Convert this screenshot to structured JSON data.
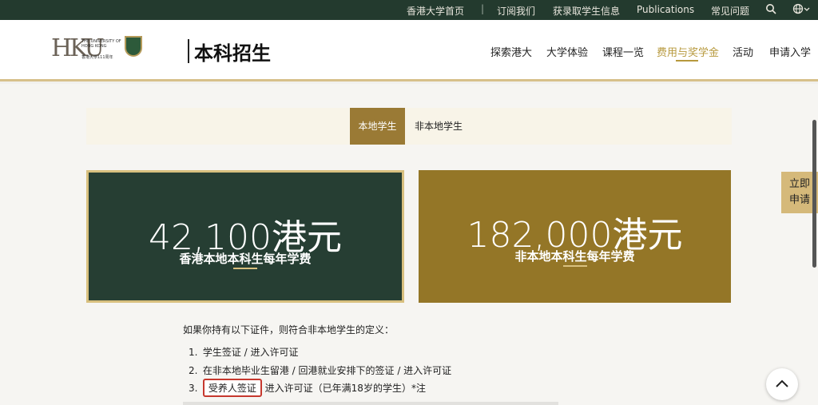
{
  "topbar": {
    "links": [
      "香港大学首页",
      "订阅我们",
      "获录取学生信息",
      "Publications",
      "常见问题"
    ],
    "separator": "|",
    "icons": [
      "search-icon",
      "globe-icon"
    ]
  },
  "header": {
    "logo_letters": "HKU",
    "logo_text_en": "THE UNIVERSITY OF HONG KONG",
    "logo_text_cn": "香港大學111周年",
    "section_title": "本科招生",
    "nav": [
      "探索港大",
      "大学体验",
      "课程一览",
      "费用与奖学金",
      "活动",
      "申请入学"
    ],
    "active_nav": "费用与奖学金",
    "accent_color": "#b7993d"
  },
  "tabs": {
    "local": "本地学生",
    "non_local": "非本地学生"
  },
  "fees": {
    "local": {
      "amount": "42,100港元",
      "desc": "香港本地本科生每年学费",
      "color": "#263e33"
    },
    "non_local": {
      "amount": "182,000港元",
      "desc": "非本地本科生每年学费",
      "color": "#947627"
    }
  },
  "apply_button": {
    "line1": "立即",
    "line2": "申请"
  },
  "definition": {
    "intro": "如果你持有以下证件，则符合非本地学生的定义：",
    "items": [
      {
        "num": "1.",
        "text": "学生签证 / 进入许可证"
      },
      {
        "num": "2.",
        "text": "在非本地毕业生留港 / 回港就业安排下的签证 / 进入许可证"
      },
      {
        "num": "3.",
        "highlight": "受养人签证",
        "text": "进入许可证（已年满18岁的学生）*注"
      }
    ]
  }
}
